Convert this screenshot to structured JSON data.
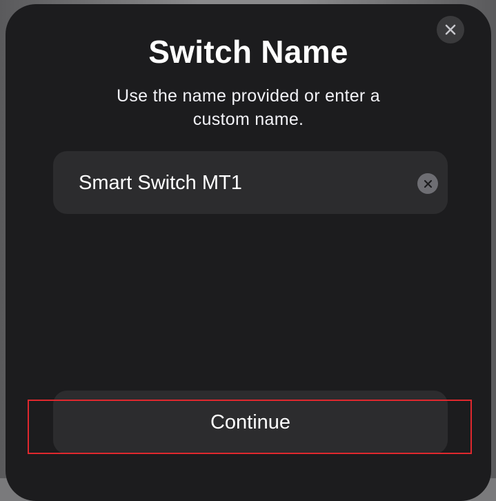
{
  "dialog": {
    "title": "Switch Name",
    "subtitle": "Use the name provided or enter a custom name.",
    "close_icon": "close-icon"
  },
  "name_field": {
    "value": "Smart Switch MT1",
    "clear_icon": "clear-circle-icon"
  },
  "actions": {
    "continue_label": "Continue"
  },
  "colors": {
    "sheet_background": "#1c1c1e",
    "field_background": "#2c2c2e",
    "text_primary": "#ffffff",
    "highlight_border": "#e0282e"
  }
}
